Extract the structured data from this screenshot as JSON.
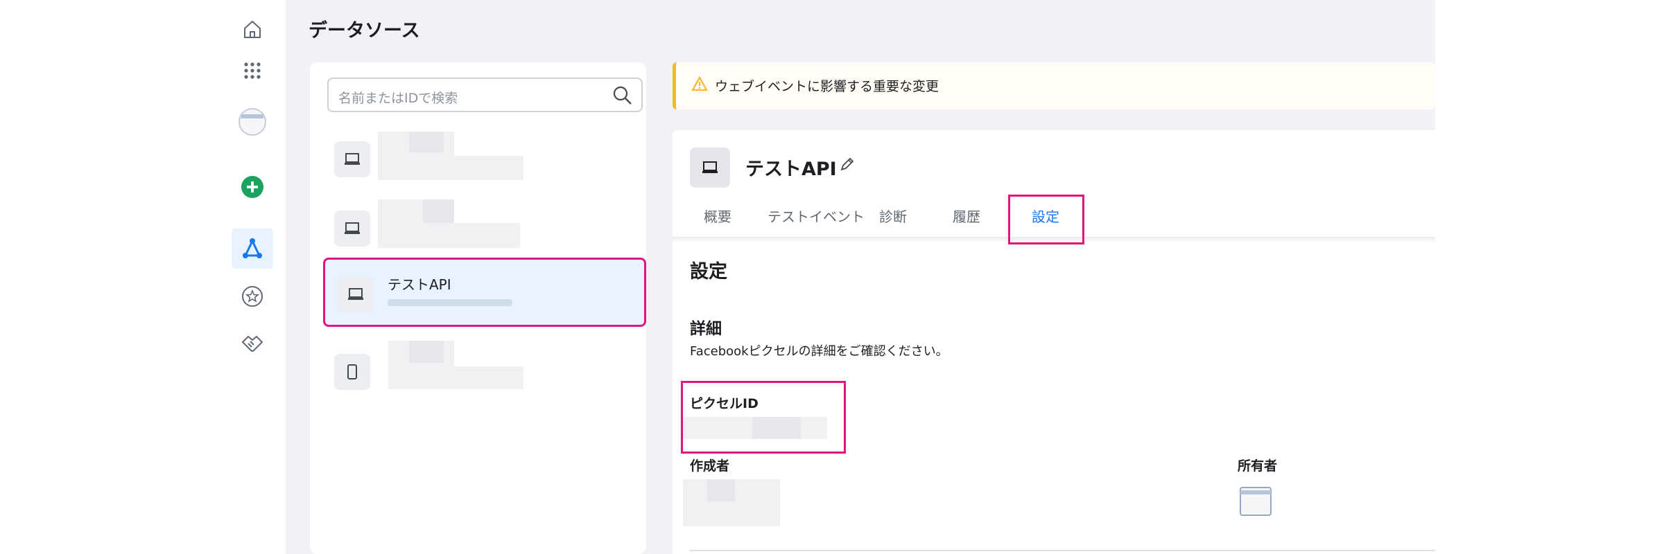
{
  "page": {
    "title": "データソース"
  },
  "rail": {
    "icons": [
      "home-icon",
      "apps-grid-icon",
      "profile-avatar-icon",
      "create-plus-icon",
      "events-manager-icon",
      "favorites-star-icon",
      "partners-handshake-icon"
    ]
  },
  "search": {
    "placeholder": "名前またはIDで検索"
  },
  "sources": [
    {
      "name": "",
      "device": "desktop"
    },
    {
      "name": "",
      "device": "desktop"
    },
    {
      "name": "テストAPI",
      "device": "desktop",
      "selected": true
    },
    {
      "name": "",
      "device": "mobile"
    }
  ],
  "banner": {
    "text": "ウェブイベントに影響する重要な変更"
  },
  "detail": {
    "name": "テストAPI",
    "tabs": [
      "概要",
      "テストイベント",
      "診断",
      "履歴",
      "設定"
    ],
    "active_tab": "設定",
    "section_title": "設定",
    "details_title": "詳細",
    "details_desc": "Facebookピクセルの詳細をご確認ください。",
    "pixel_id_label": "ピクセルID",
    "creator_label": "作成者",
    "owner_label": "所有者"
  },
  "colors": {
    "accent": "#1877f2",
    "highlight": "#e0157f",
    "warning": "#f7b928",
    "create": "#1aa260"
  }
}
